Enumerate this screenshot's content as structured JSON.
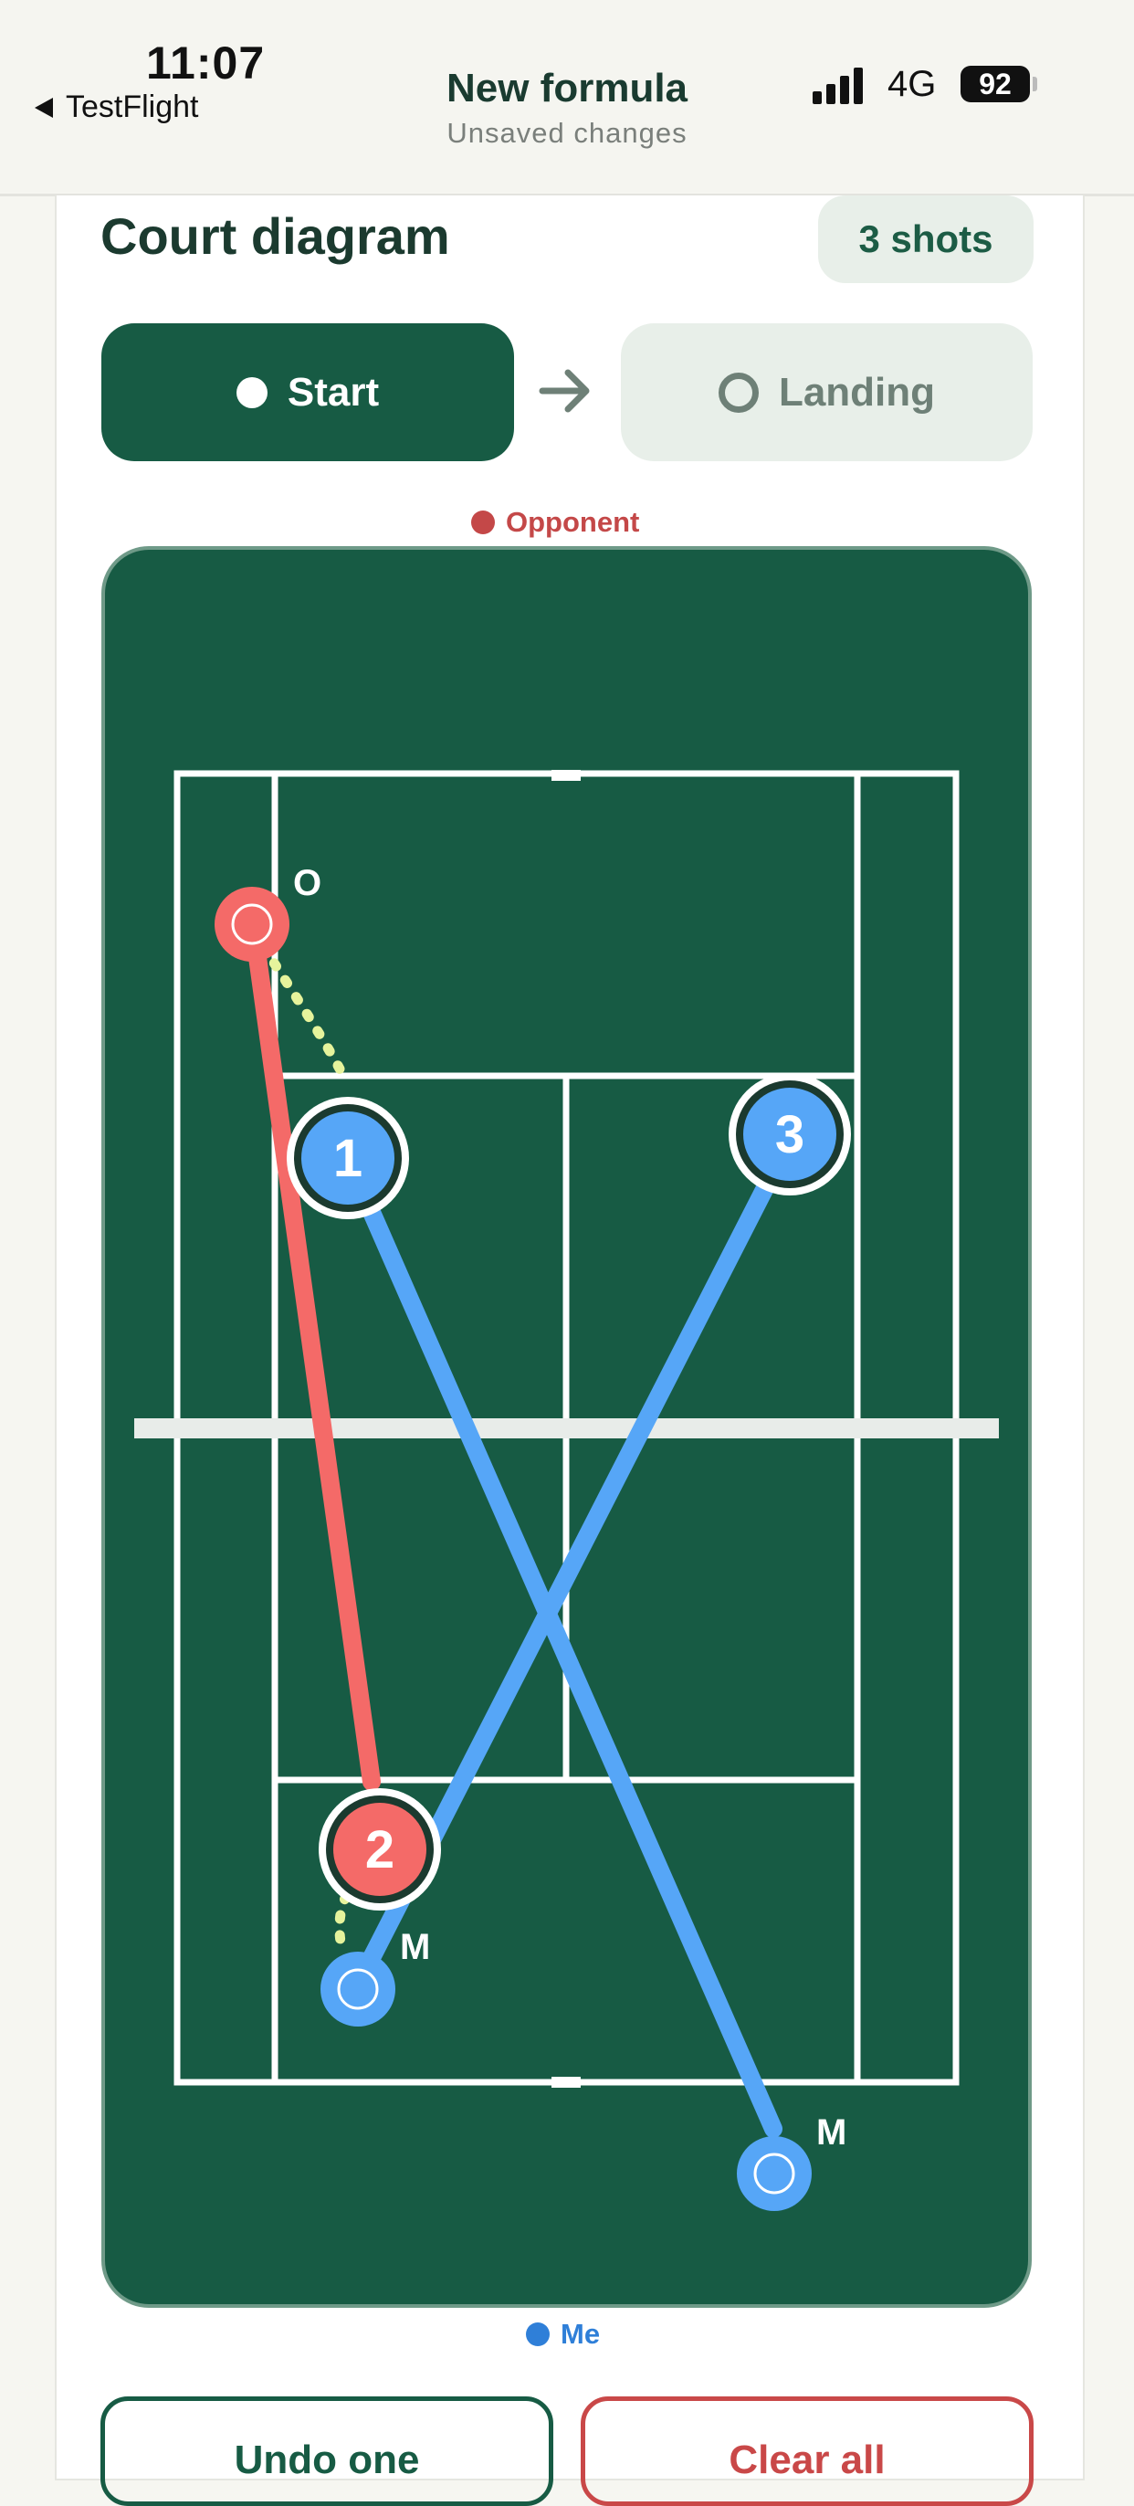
{
  "status": {
    "time": "11:07",
    "back_app": "TestFlight",
    "network": "4G",
    "battery": "92"
  },
  "nav": {
    "title": "New formula",
    "subtitle": "Unsaved changes"
  },
  "card": {
    "title": "Court diagram",
    "shots_badge": "3 shots"
  },
  "mode": {
    "start_label": "Start",
    "landing_label": "Landing",
    "selected": "start"
  },
  "legend": {
    "opponent": "Opponent",
    "me": "Me"
  },
  "colors": {
    "court": "#175b44",
    "lines": "#ffffff",
    "net": "#e8ece9",
    "opponent": "#f46a68",
    "me": "#56a6f7",
    "trail": "#e6f39c",
    "accent": "#175b44",
    "danger": "#c94848"
  },
  "diagram": {
    "players": [
      {
        "role": "opponent",
        "label": "O"
      },
      {
        "role": "me",
        "label": "M"
      },
      {
        "role": "me",
        "label": "M"
      }
    ],
    "shots": [
      {
        "number": "1",
        "side": "me"
      },
      {
        "number": "2",
        "side": "opponent"
      },
      {
        "number": "3",
        "side": "me"
      }
    ]
  },
  "actions": {
    "undo_label": "Undo one",
    "clear_label": "Clear all"
  }
}
